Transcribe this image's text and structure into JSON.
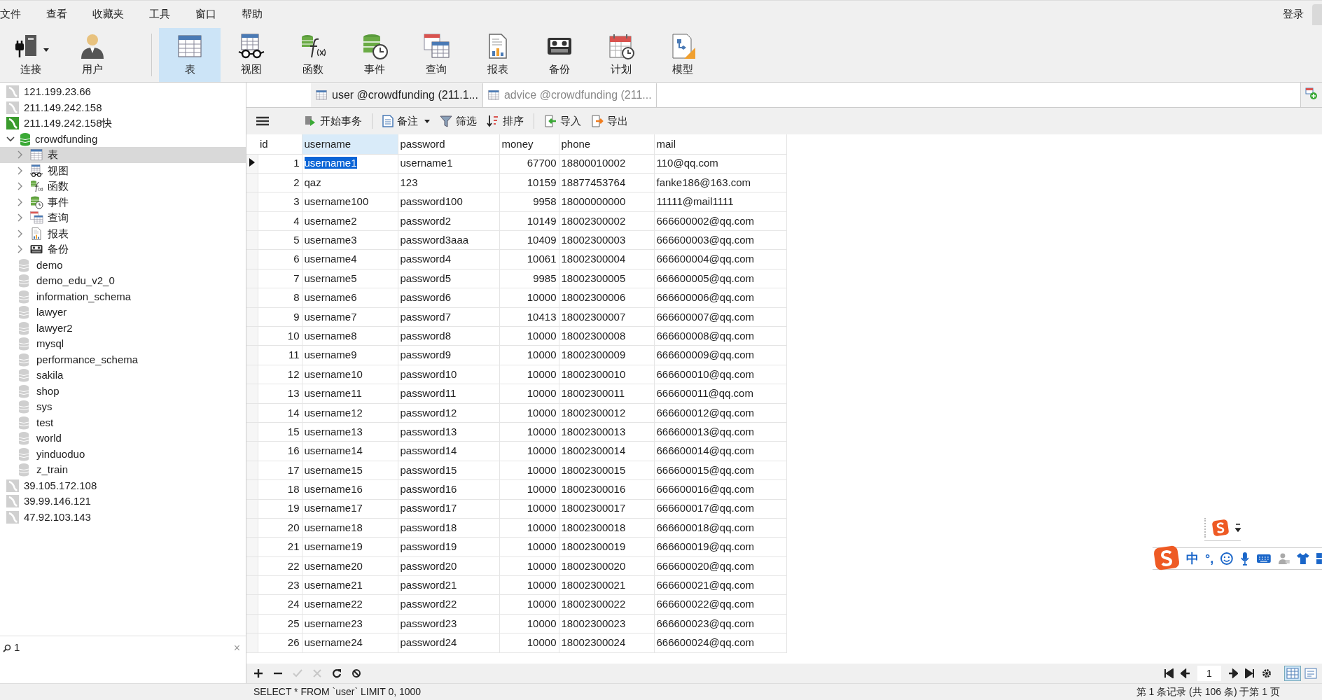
{
  "menu": [
    "文件",
    "查看",
    "收藏夹",
    "工具",
    "窗口",
    "帮助"
  ],
  "account": {
    "label": "登录"
  },
  "toolbar": [
    {
      "kind": "connection",
      "label": "连接",
      "selected": false,
      "dropdown": true
    },
    {
      "kind": "user",
      "label": "用户",
      "selected": false,
      "dropdown": false
    },
    {
      "kind": "table",
      "label": "表",
      "selected": true,
      "dropdown": false
    },
    {
      "kind": "view",
      "label": "视图",
      "selected": false,
      "dropdown": false
    },
    {
      "kind": "function",
      "label": "函数",
      "selected": false,
      "dropdown": false
    },
    {
      "kind": "event",
      "label": "事件",
      "selected": false,
      "dropdown": false
    },
    {
      "kind": "query",
      "label": "查询",
      "selected": false,
      "dropdown": false
    },
    {
      "kind": "report",
      "label": "报表",
      "selected": false,
      "dropdown": false
    },
    {
      "kind": "backup",
      "label": "备份",
      "selected": false,
      "dropdown": false
    },
    {
      "kind": "schedule",
      "label": "计划",
      "selected": false,
      "dropdown": false
    },
    {
      "kind": "model",
      "label": "模型",
      "selected": false,
      "dropdown": false
    }
  ],
  "tree": [
    {
      "kind": "connection",
      "label": "121.199.23.66",
      "open": false
    },
    {
      "kind": "connection",
      "label": "211.149.242.158",
      "open": false
    },
    {
      "kind": "connection",
      "label": "211.149.242.158快",
      "open": true,
      "children": [
        {
          "kind": "database",
          "label": "crowdfunding",
          "expanded": true,
          "open": true,
          "children": [
            {
              "kind": "table",
              "label": "表",
              "expanded": false,
              "selected": true
            },
            {
              "kind": "view",
              "label": "视图",
              "expanded": false,
              "selected": false
            },
            {
              "kind": "function",
              "label": "函数",
              "expanded": false,
              "selected": false
            },
            {
              "kind": "event",
              "label": "事件",
              "expanded": false,
              "selected": false
            },
            {
              "kind": "query",
              "label": "查询",
              "expanded": false,
              "selected": false
            },
            {
              "kind": "report",
              "label": "报表",
              "expanded": false,
              "selected": false
            },
            {
              "kind": "backup",
              "label": "备份",
              "expanded": false,
              "selected": false
            }
          ]
        },
        {
          "kind": "database",
          "label": "demo",
          "open": false
        },
        {
          "kind": "database",
          "label": "demo_edu_v2_0",
          "open": false
        },
        {
          "kind": "database",
          "label": "information_schema",
          "open": false
        },
        {
          "kind": "database",
          "label": "lawyer",
          "open": false
        },
        {
          "kind": "database",
          "label": "lawyer2",
          "open": false
        },
        {
          "kind": "database",
          "label": "mysql",
          "open": false
        },
        {
          "kind": "database",
          "label": "performance_schema",
          "open": false
        },
        {
          "kind": "database",
          "label": "sakila",
          "open": false
        },
        {
          "kind": "database",
          "label": "shop",
          "open": false
        },
        {
          "kind": "database",
          "label": "sys",
          "open": false
        },
        {
          "kind": "database",
          "label": "test",
          "open": false
        },
        {
          "kind": "database",
          "label": "world",
          "open": false
        },
        {
          "kind": "database",
          "label": "yinduoduo",
          "open": false
        },
        {
          "kind": "database",
          "label": "z_train",
          "open": false
        }
      ]
    },
    {
      "kind": "connection",
      "label": "39.105.172.108",
      "open": false
    },
    {
      "kind": "connection",
      "label": "39.99.146.121",
      "open": false
    },
    {
      "kind": "connection",
      "label": "47.92.103.143",
      "open": false
    }
  ],
  "sidebar_search": {
    "value": "1",
    "clear": "×"
  },
  "tabs": [
    {
      "label": "user @crowdfunding (211.1...",
      "selected": true
    },
    {
      "label": "advice @crowdfunding (211...",
      "selected": false
    }
  ],
  "grid_toolbar": [
    {
      "kind": "menu"
    },
    {
      "kind": "transaction",
      "label": "开始事务",
      "dropdown": false
    },
    {
      "kind": "note",
      "label": "备注",
      "dropdown": true
    },
    {
      "kind": "filter",
      "label": "筛选",
      "dropdown": false
    },
    {
      "kind": "sort",
      "label": "排序",
      "dropdown": false
    },
    {
      "kind": "import",
      "label": "导入",
      "dropdown": false
    },
    {
      "kind": "export",
      "label": "导出",
      "dropdown": false
    }
  ],
  "table": {
    "columns": [
      {
        "label": "id",
        "kind": "number",
        "selected": false
      },
      {
        "label": "username",
        "kind": "text",
        "selected": true
      },
      {
        "label": "password",
        "kind": "text",
        "selected": false
      },
      {
        "label": "money",
        "kind": "number",
        "selected": false
      },
      {
        "label": "phone",
        "kind": "text",
        "selected": false
      },
      {
        "label": "mail",
        "kind": "text",
        "selected": false
      }
    ],
    "rows": [
      {
        "current": true,
        "cells": [
          "1",
          "username1",
          "username1",
          "67700",
          "18800010002",
          "110@qq.com"
        ]
      },
      {
        "current": false,
        "cells": [
          "2",
          "qaz",
          "123",
          "10159",
          "18877453764",
          "fanke186@163.com"
        ]
      },
      {
        "current": false,
        "cells": [
          "3",
          "username100",
          "password100",
          "9958",
          "18000000000",
          "11111@mail1111"
        ]
      },
      {
        "current": false,
        "cells": [
          "4",
          "username2",
          "password2",
          "10149",
          "18002300002",
          "666600002@qq.com"
        ]
      },
      {
        "current": false,
        "cells": [
          "5",
          "username3",
          "password3aaa",
          "10409",
          "18002300003",
          "666600003@qq.com"
        ]
      },
      {
        "current": false,
        "cells": [
          "6",
          "username4",
          "password4",
          "10061",
          "18002300004",
          "666600004@qq.com"
        ]
      },
      {
        "current": false,
        "cells": [
          "7",
          "username5",
          "password5",
          "9985",
          "18002300005",
          "666600005@qq.com"
        ]
      },
      {
        "current": false,
        "cells": [
          "8",
          "username6",
          "password6",
          "10000",
          "18002300006",
          "666600006@qq.com"
        ]
      },
      {
        "current": false,
        "cells": [
          "9",
          "username7",
          "password7",
          "10413",
          "18002300007",
          "666600007@qq.com"
        ]
      },
      {
        "current": false,
        "cells": [
          "10",
          "username8",
          "password8",
          "10000",
          "18002300008",
          "666600008@qq.com"
        ]
      },
      {
        "current": false,
        "cells": [
          "11",
          "username9",
          "password9",
          "10000",
          "18002300009",
          "666600009@qq.com"
        ]
      },
      {
        "current": false,
        "cells": [
          "12",
          "username10",
          "password10",
          "10000",
          "18002300010",
          "666600010@qq.com"
        ]
      },
      {
        "current": false,
        "cells": [
          "13",
          "username11",
          "password11",
          "10000",
          "18002300011",
          "666600011@qq.com"
        ]
      },
      {
        "current": false,
        "cells": [
          "14",
          "username12",
          "password12",
          "10000",
          "18002300012",
          "666600012@qq.com"
        ]
      },
      {
        "current": false,
        "cells": [
          "15",
          "username13",
          "password13",
          "10000",
          "18002300013",
          "666600013@qq.com"
        ]
      },
      {
        "current": false,
        "cells": [
          "16",
          "username14",
          "password14",
          "10000",
          "18002300014",
          "666600014@qq.com"
        ]
      },
      {
        "current": false,
        "cells": [
          "17",
          "username15",
          "password15",
          "10000",
          "18002300015",
          "666600015@qq.com"
        ]
      },
      {
        "current": false,
        "cells": [
          "18",
          "username16",
          "password16",
          "10000",
          "18002300016",
          "666600016@qq.com"
        ]
      },
      {
        "current": false,
        "cells": [
          "19",
          "username17",
          "password17",
          "10000",
          "18002300017",
          "666600017@qq.com"
        ]
      },
      {
        "current": false,
        "cells": [
          "20",
          "username18",
          "password18",
          "10000",
          "18002300018",
          "666600018@qq.com"
        ]
      },
      {
        "current": false,
        "cells": [
          "21",
          "username19",
          "password19",
          "10000",
          "18002300019",
          "666600019@qq.com"
        ]
      },
      {
        "current": false,
        "cells": [
          "22",
          "username20",
          "password20",
          "10000",
          "18002300020",
          "666600020@qq.com"
        ]
      },
      {
        "current": false,
        "cells": [
          "23",
          "username21",
          "password21",
          "10000",
          "18002300021",
          "666600021@qq.com"
        ]
      },
      {
        "current": false,
        "cells": [
          "24",
          "username22",
          "password22",
          "10000",
          "18002300022",
          "666600022@qq.com"
        ]
      },
      {
        "current": false,
        "cells": [
          "25",
          "username23",
          "password23",
          "10000",
          "18002300023",
          "666600023@qq.com"
        ]
      },
      {
        "current": false,
        "cells": [
          "26",
          "username24",
          "password24",
          "10000",
          "18002300024",
          "666600024@qq.com"
        ]
      }
    ]
  },
  "record_actions": [
    {
      "kind": "add",
      "disabled": false
    },
    {
      "kind": "delete",
      "disabled": false
    },
    {
      "kind": "apply",
      "disabled": true
    },
    {
      "kind": "cancel",
      "disabled": true
    },
    {
      "kind": "refresh",
      "disabled": false
    },
    {
      "kind": "stop",
      "disabled": false
    }
  ],
  "pager": {
    "page": "1"
  },
  "view_modes": [
    {
      "kind": "grid",
      "selected": true
    },
    {
      "kind": "form",
      "selected": false
    }
  ],
  "status": {
    "sql": "SELECT * FROM `user` LIMIT 0, 1000",
    "records": "第 1 条记录 (共 106 条) 于第 1 页"
  },
  "ime": {
    "mode": "中",
    "punct": "°,"
  }
}
